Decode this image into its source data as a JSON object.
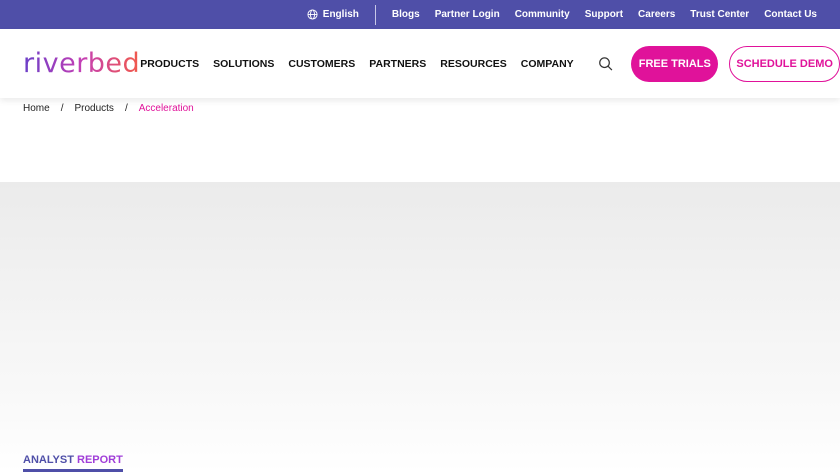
{
  "topbar": {
    "language": "English",
    "links": [
      "Blogs",
      "Partner Login",
      "Community",
      "Support",
      "Careers",
      "Trust Center",
      "Contact Us"
    ]
  },
  "header": {
    "logo": "riverbed",
    "nav": [
      "PRODUCTS",
      "SOLUTIONS",
      "CUSTOMERS",
      "PARTNERS",
      "RESOURCES",
      "COMPANY"
    ],
    "free_trials": "FREE TRIALS",
    "schedule_demo": "SCHEDULE DEMO"
  },
  "breadcrumb": {
    "items": [
      "Home",
      "Products"
    ],
    "separator": "/",
    "current": "Acceleration"
  },
  "section": {
    "label_part1": "ANALYST",
    "label_part2": "REPORT"
  },
  "colors": {
    "topbar": "#4f4fa8",
    "accent": "#e0129a"
  }
}
